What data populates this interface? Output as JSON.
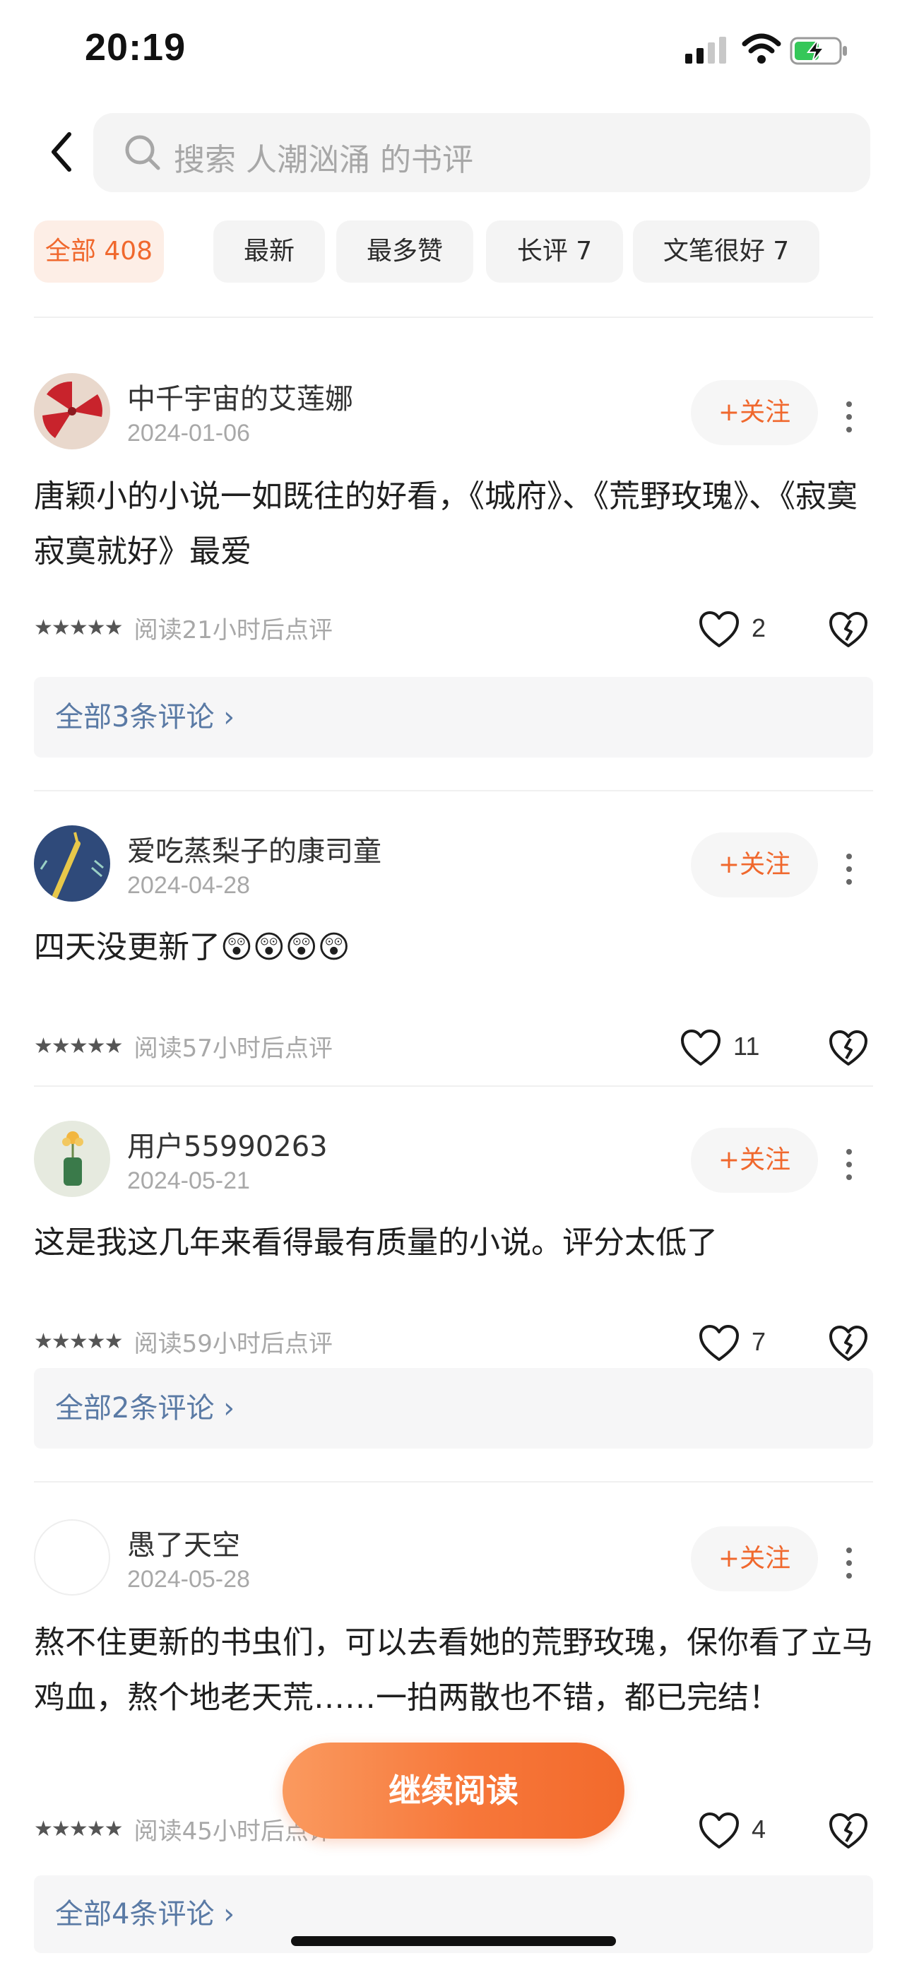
{
  "status_bar": {
    "time": "20:19"
  },
  "search": {
    "placeholder": "搜索 人潮汹涌 的书评"
  },
  "tabs": [
    {
      "label": "全部 408",
      "active": true
    },
    {
      "label": "最新",
      "active": false
    },
    {
      "label": "最多赞",
      "active": false
    },
    {
      "label": "长评 7",
      "active": false
    },
    {
      "label": "文笔很好 7",
      "active": false
    }
  ],
  "reviews": [
    {
      "user": "中千宇宙的艾莲娜",
      "date": "2024-01-06",
      "follow_label": "+关注",
      "text": "唐颖小的小说一如既往的好看，《城府》、《荒野玫瑰》、《寂寞寂寞就好》最爱",
      "stars": "★★★★★",
      "read_note": "阅读21小时后点评",
      "likes": "2",
      "comments_label": "全部3条评论 ›"
    },
    {
      "user": "爱吃蒸梨子的康司童",
      "date": "2024-04-28",
      "follow_label": "+关注",
      "text": "四天没更新了😲😲😲😲",
      "stars": "★★★★★",
      "read_note": "阅读57小时后点评",
      "likes": "11"
    },
    {
      "user": "用户55990263",
      "date": "2024-05-21",
      "follow_label": "+关注",
      "text": "这是我这几年来看得最有质量的小说。评分太低了",
      "stars": "★★★★★",
      "read_note": "阅读59小时后点评",
      "likes": "7",
      "comments_label": "全部2条评论 ›"
    },
    {
      "user": "愚了天空",
      "date": "2024-05-28",
      "follow_label": "+关注",
      "text": "熬不住更新的书虫们，可以去看她的荒野玫瑰，保你看了立马鸡血，熬个地老天荒……一拍两散也不错，都已完结！",
      "stars": "★★★★★",
      "read_note": "阅读45小时后点评",
      "likes": "4",
      "comments_label": "全部4条评论 ›"
    }
  ],
  "continue_button": "继续阅读",
  "colors": {
    "accent": "#f0682d",
    "link": "#5a7aa5",
    "muted": "#a8a8a8"
  }
}
